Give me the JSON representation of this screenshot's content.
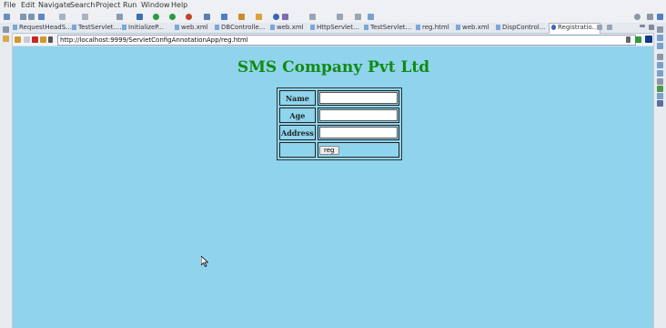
{
  "menu": [
    "File",
    "Edit",
    "Navigate",
    "Search",
    "Project",
    "Run",
    "Window",
    "Help"
  ],
  "tabs": [
    "RequestHeadS...",
    "TestServlet....",
    "InitializeP...",
    "web.xml",
    "DBControlle...",
    "web.xml",
    "HttpServlet...",
    "TestServlet...",
    "reg.html",
    "web.xml",
    "DispControl...",
    "Registratio..."
  ],
  "browser": {
    "url": "http://localhost:9999/ServletConfigAnnotationApp/reg.html"
  },
  "page": {
    "title": "SMS Company Pvt Ltd",
    "labels": {
      "name": "Name",
      "age": "Age",
      "address": "Address"
    },
    "fields": {
      "name": "",
      "age": "",
      "address": ""
    },
    "button": "reg"
  },
  "colors": {
    "page_bg": "#8fd4ec",
    "title": "#138a13"
  }
}
